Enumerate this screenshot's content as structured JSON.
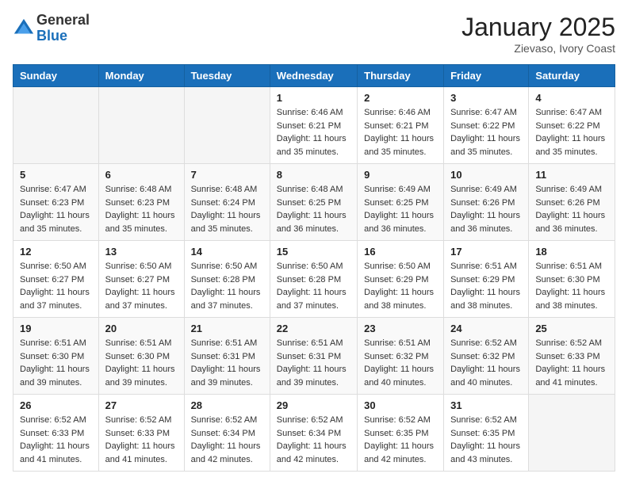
{
  "header": {
    "logo_general": "General",
    "logo_blue": "Blue",
    "month_title": "January 2025",
    "location": "Zievaso, Ivory Coast"
  },
  "weekdays": [
    "Sunday",
    "Monday",
    "Tuesday",
    "Wednesday",
    "Thursday",
    "Friday",
    "Saturday"
  ],
  "weeks": [
    [
      {
        "day": "",
        "sunrise": "",
        "sunset": "",
        "daylight": ""
      },
      {
        "day": "",
        "sunrise": "",
        "sunset": "",
        "daylight": ""
      },
      {
        "day": "",
        "sunrise": "",
        "sunset": "",
        "daylight": ""
      },
      {
        "day": "1",
        "sunrise": "Sunrise: 6:46 AM",
        "sunset": "Sunset: 6:21 PM",
        "daylight": "Daylight: 11 hours and 35 minutes."
      },
      {
        "day": "2",
        "sunrise": "Sunrise: 6:46 AM",
        "sunset": "Sunset: 6:21 PM",
        "daylight": "Daylight: 11 hours and 35 minutes."
      },
      {
        "day": "3",
        "sunrise": "Sunrise: 6:47 AM",
        "sunset": "Sunset: 6:22 PM",
        "daylight": "Daylight: 11 hours and 35 minutes."
      },
      {
        "day": "4",
        "sunrise": "Sunrise: 6:47 AM",
        "sunset": "Sunset: 6:22 PM",
        "daylight": "Daylight: 11 hours and 35 minutes."
      }
    ],
    [
      {
        "day": "5",
        "sunrise": "Sunrise: 6:47 AM",
        "sunset": "Sunset: 6:23 PM",
        "daylight": "Daylight: 11 hours and 35 minutes."
      },
      {
        "day": "6",
        "sunrise": "Sunrise: 6:48 AM",
        "sunset": "Sunset: 6:23 PM",
        "daylight": "Daylight: 11 hours and 35 minutes."
      },
      {
        "day": "7",
        "sunrise": "Sunrise: 6:48 AM",
        "sunset": "Sunset: 6:24 PM",
        "daylight": "Daylight: 11 hours and 35 minutes."
      },
      {
        "day": "8",
        "sunrise": "Sunrise: 6:48 AM",
        "sunset": "Sunset: 6:25 PM",
        "daylight": "Daylight: 11 hours and 36 minutes."
      },
      {
        "day": "9",
        "sunrise": "Sunrise: 6:49 AM",
        "sunset": "Sunset: 6:25 PM",
        "daylight": "Daylight: 11 hours and 36 minutes."
      },
      {
        "day": "10",
        "sunrise": "Sunrise: 6:49 AM",
        "sunset": "Sunset: 6:26 PM",
        "daylight": "Daylight: 11 hours and 36 minutes."
      },
      {
        "day": "11",
        "sunrise": "Sunrise: 6:49 AM",
        "sunset": "Sunset: 6:26 PM",
        "daylight": "Daylight: 11 hours and 36 minutes."
      }
    ],
    [
      {
        "day": "12",
        "sunrise": "Sunrise: 6:50 AM",
        "sunset": "Sunset: 6:27 PM",
        "daylight": "Daylight: 11 hours and 37 minutes."
      },
      {
        "day": "13",
        "sunrise": "Sunrise: 6:50 AM",
        "sunset": "Sunset: 6:27 PM",
        "daylight": "Daylight: 11 hours and 37 minutes."
      },
      {
        "day": "14",
        "sunrise": "Sunrise: 6:50 AM",
        "sunset": "Sunset: 6:28 PM",
        "daylight": "Daylight: 11 hours and 37 minutes."
      },
      {
        "day": "15",
        "sunrise": "Sunrise: 6:50 AM",
        "sunset": "Sunset: 6:28 PM",
        "daylight": "Daylight: 11 hours and 37 minutes."
      },
      {
        "day": "16",
        "sunrise": "Sunrise: 6:50 AM",
        "sunset": "Sunset: 6:29 PM",
        "daylight": "Daylight: 11 hours and 38 minutes."
      },
      {
        "day": "17",
        "sunrise": "Sunrise: 6:51 AM",
        "sunset": "Sunset: 6:29 PM",
        "daylight": "Daylight: 11 hours and 38 minutes."
      },
      {
        "day": "18",
        "sunrise": "Sunrise: 6:51 AM",
        "sunset": "Sunset: 6:30 PM",
        "daylight": "Daylight: 11 hours and 38 minutes."
      }
    ],
    [
      {
        "day": "19",
        "sunrise": "Sunrise: 6:51 AM",
        "sunset": "Sunset: 6:30 PM",
        "daylight": "Daylight: 11 hours and 39 minutes."
      },
      {
        "day": "20",
        "sunrise": "Sunrise: 6:51 AM",
        "sunset": "Sunset: 6:30 PM",
        "daylight": "Daylight: 11 hours and 39 minutes."
      },
      {
        "day": "21",
        "sunrise": "Sunrise: 6:51 AM",
        "sunset": "Sunset: 6:31 PM",
        "daylight": "Daylight: 11 hours and 39 minutes."
      },
      {
        "day": "22",
        "sunrise": "Sunrise: 6:51 AM",
        "sunset": "Sunset: 6:31 PM",
        "daylight": "Daylight: 11 hours and 39 minutes."
      },
      {
        "day": "23",
        "sunrise": "Sunrise: 6:51 AM",
        "sunset": "Sunset: 6:32 PM",
        "daylight": "Daylight: 11 hours and 40 minutes."
      },
      {
        "day": "24",
        "sunrise": "Sunrise: 6:52 AM",
        "sunset": "Sunset: 6:32 PM",
        "daylight": "Daylight: 11 hours and 40 minutes."
      },
      {
        "day": "25",
        "sunrise": "Sunrise: 6:52 AM",
        "sunset": "Sunset: 6:33 PM",
        "daylight": "Daylight: 11 hours and 41 minutes."
      }
    ],
    [
      {
        "day": "26",
        "sunrise": "Sunrise: 6:52 AM",
        "sunset": "Sunset: 6:33 PM",
        "daylight": "Daylight: 11 hours and 41 minutes."
      },
      {
        "day": "27",
        "sunrise": "Sunrise: 6:52 AM",
        "sunset": "Sunset: 6:33 PM",
        "daylight": "Daylight: 11 hours and 41 minutes."
      },
      {
        "day": "28",
        "sunrise": "Sunrise: 6:52 AM",
        "sunset": "Sunset: 6:34 PM",
        "daylight": "Daylight: 11 hours and 42 minutes."
      },
      {
        "day": "29",
        "sunrise": "Sunrise: 6:52 AM",
        "sunset": "Sunset: 6:34 PM",
        "daylight": "Daylight: 11 hours and 42 minutes."
      },
      {
        "day": "30",
        "sunrise": "Sunrise: 6:52 AM",
        "sunset": "Sunset: 6:35 PM",
        "daylight": "Daylight: 11 hours and 42 minutes."
      },
      {
        "day": "31",
        "sunrise": "Sunrise: 6:52 AM",
        "sunset": "Sunset: 6:35 PM",
        "daylight": "Daylight: 11 hours and 43 minutes."
      },
      {
        "day": "",
        "sunrise": "",
        "sunset": "",
        "daylight": ""
      }
    ]
  ]
}
